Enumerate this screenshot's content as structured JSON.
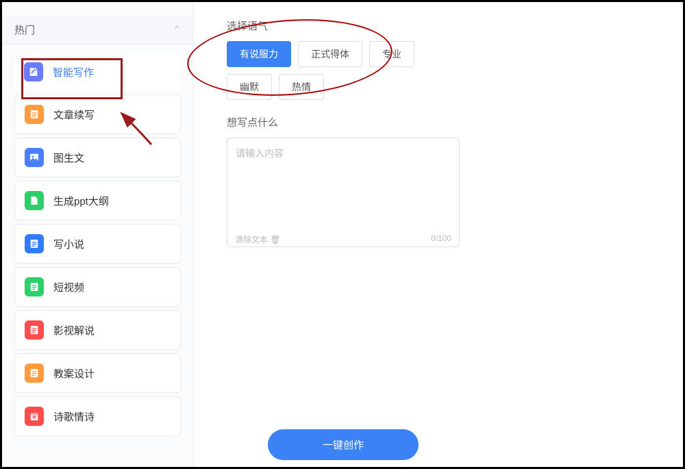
{
  "sidebar": {
    "header_title": "热门",
    "items": [
      {
        "label": "智能写作",
        "icon": "doc-edit",
        "bg": "#6b7cff",
        "active": true
      },
      {
        "label": "文章续写",
        "icon": "doc-lines",
        "bg": "#ff9a3d",
        "active": false
      },
      {
        "label": "图生文",
        "icon": "image-doc",
        "bg": "#4a7dff",
        "active": false
      },
      {
        "label": "生成ppt大纲",
        "icon": "doc-fold",
        "bg": "#2dcf6b",
        "active": false
      },
      {
        "label": "写小说",
        "icon": "doc-lines",
        "bg": "#2f7cff",
        "active": false
      },
      {
        "label": "短视频",
        "icon": "doc-lines",
        "bg": "#2dcf6b",
        "active": false
      },
      {
        "label": "影视解说",
        "icon": "doc-lines",
        "bg": "#ff4d4d",
        "active": false
      },
      {
        "label": "教案设计",
        "icon": "doc-lines",
        "bg": "#ff9a3d",
        "active": false
      },
      {
        "label": "诗歌情诗",
        "icon": "calendar",
        "bg": "#ff4d4d",
        "active": false
      }
    ]
  },
  "main": {
    "tone_label": "选择语气",
    "tones": [
      {
        "label": "有说服力",
        "selected": true
      },
      {
        "label": "正式得体",
        "selected": false
      },
      {
        "label": "专业",
        "selected": false
      },
      {
        "label": "幽默",
        "selected": false
      },
      {
        "label": "热情",
        "selected": false
      }
    ],
    "prompt_label": "想写点什么",
    "textarea_placeholder": "请输入内容",
    "clear_label": "清除文本 🗑",
    "char_count": "0/100",
    "submit_label": "一键创作"
  }
}
